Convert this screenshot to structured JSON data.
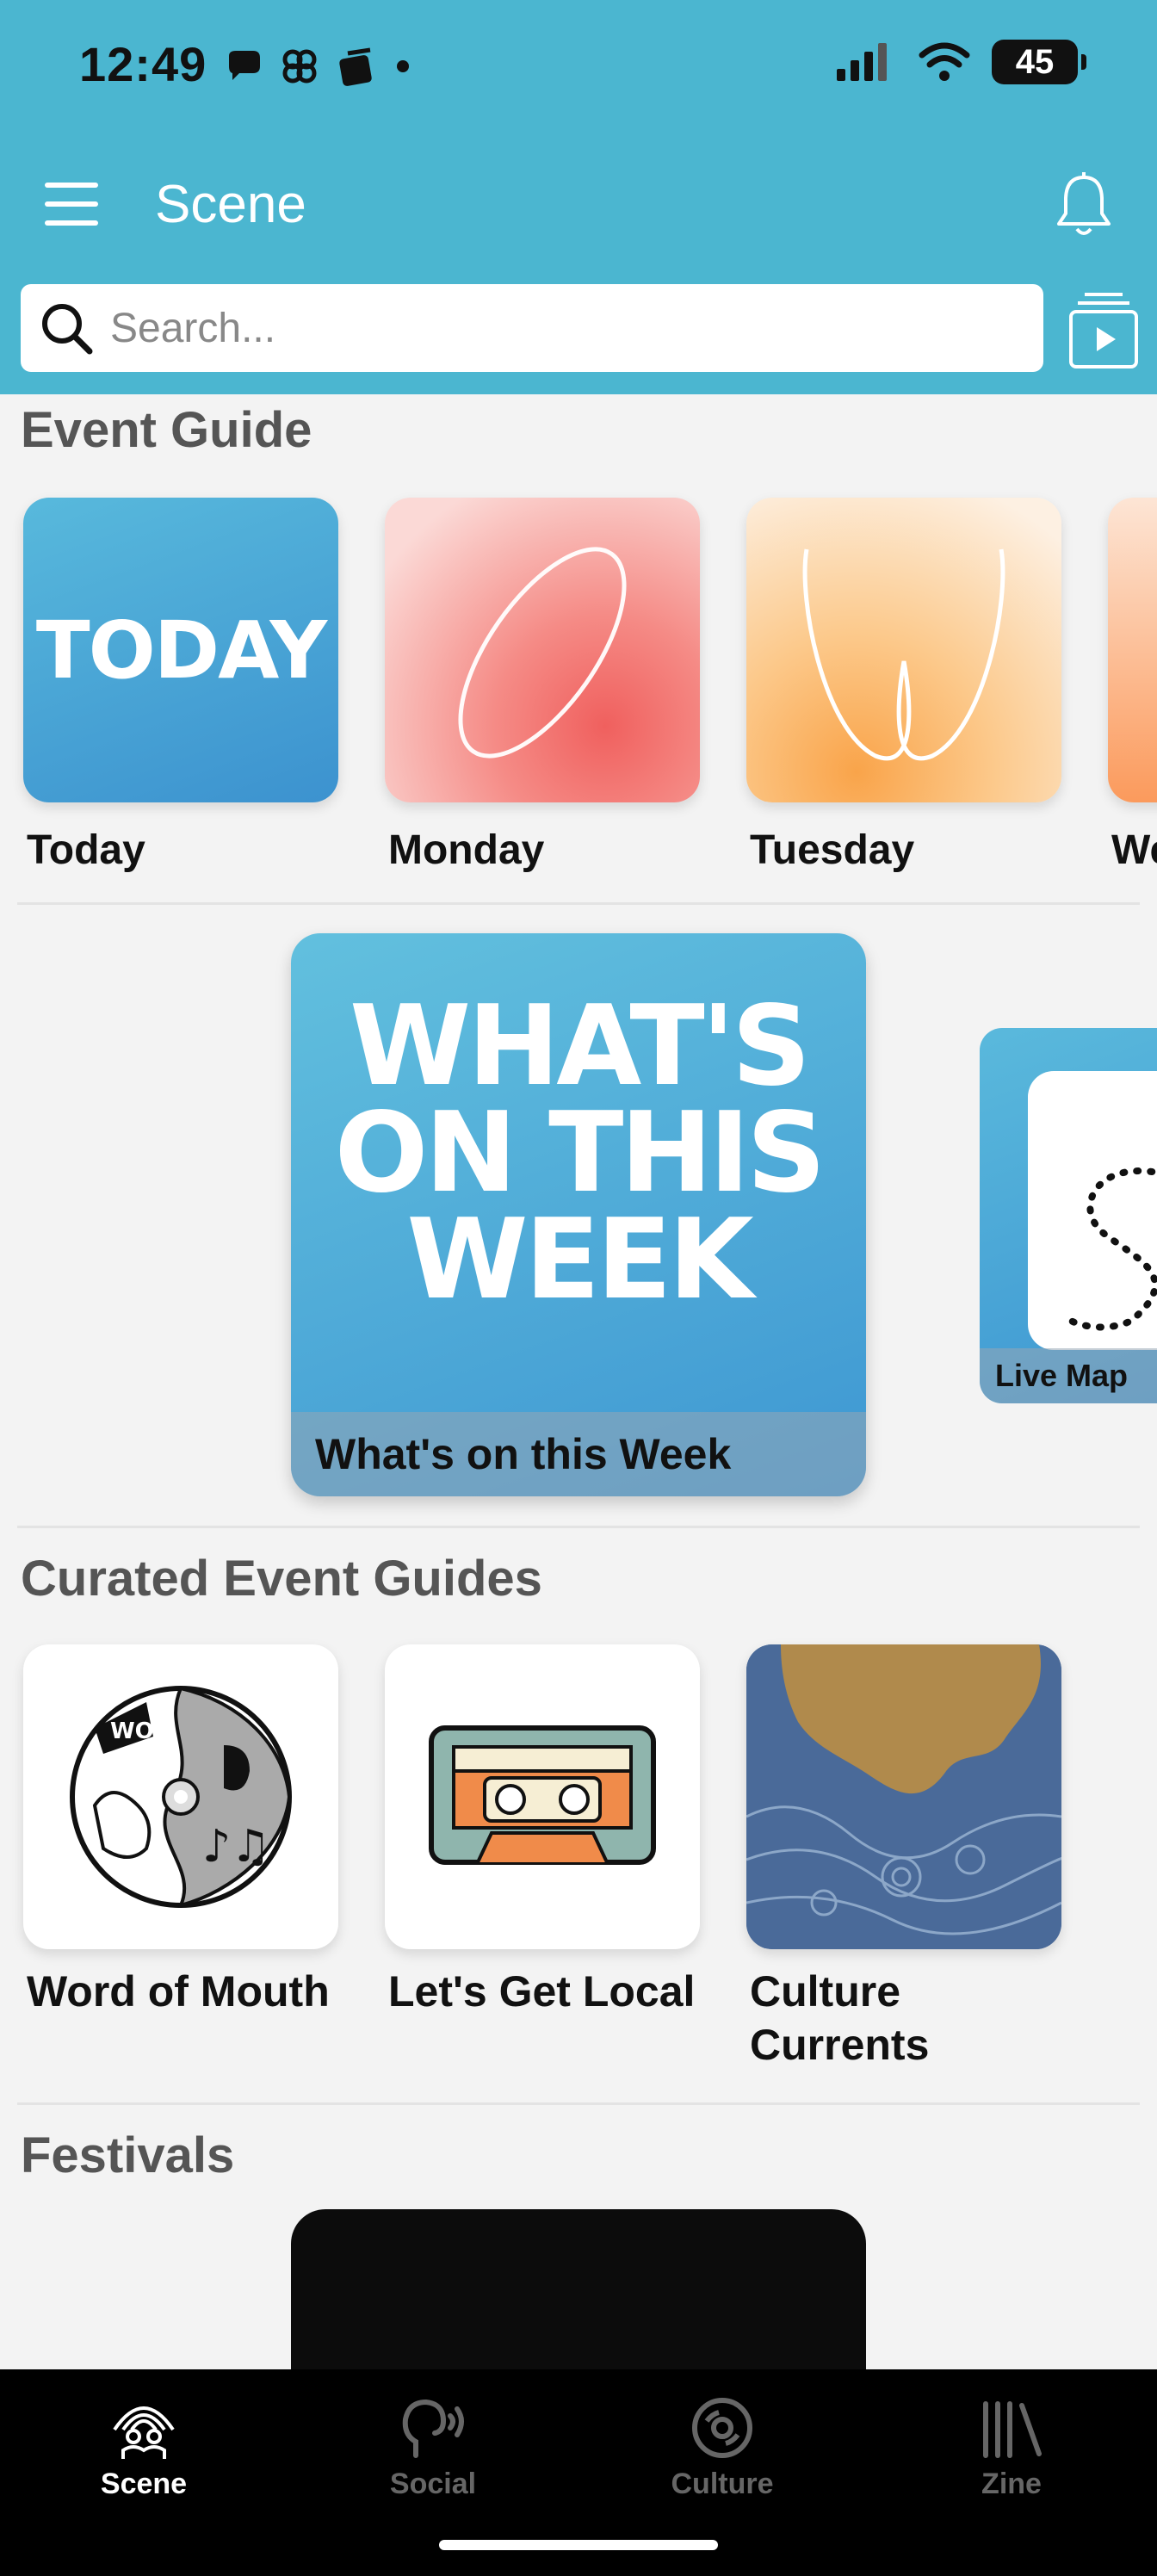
{
  "status_bar": {
    "time": "12:49",
    "battery": "45",
    "icons_left": [
      "chat-bubble-icon",
      "pinwheel-icon",
      "layers-icon",
      "dot-icon"
    ],
    "icons_right": [
      "signal-icon",
      "wifi-icon",
      "battery-icon"
    ]
  },
  "app_bar": {
    "title": "Scene",
    "menu_icon": "hamburger-icon",
    "notification_icon": "bell-icon"
  },
  "search": {
    "placeholder": "Search...",
    "value": ""
  },
  "colors": {
    "header": "#4bb6d0",
    "tab_active": "#ffffff",
    "tab_inactive": "#666666"
  },
  "event_guide": {
    "title": "Event Guide",
    "days": [
      {
        "label": "Today",
        "tile_text": "TODAY"
      },
      {
        "label": "Monday"
      },
      {
        "label": "Tuesday"
      },
      {
        "label": "We"
      }
    ]
  },
  "featured": {
    "main": {
      "tile_text_lines": [
        "WHAT'S",
        "ON THIS",
        "WEEK"
      ],
      "caption": "What's on this Week"
    },
    "side": {
      "caption": "Live Map"
    }
  },
  "curated": {
    "title": "Curated Event Guides",
    "items": [
      {
        "label": "Word of Mouth",
        "tile_text": "WOM"
      },
      {
        "label": "Let's Get Local"
      },
      {
        "label_lines": [
          "Culture",
          "Currents"
        ]
      }
    ]
  },
  "festivals": {
    "title": "Festivals"
  },
  "tabbar": {
    "tabs": [
      {
        "label": "Scene",
        "icon": "scene-icon",
        "active": true
      },
      {
        "label": "Social",
        "icon": "social-icon",
        "active": false
      },
      {
        "label": "Culture",
        "icon": "culture-icon",
        "active": false
      },
      {
        "label": "Zine",
        "icon": "zine-icon",
        "active": false
      }
    ]
  }
}
